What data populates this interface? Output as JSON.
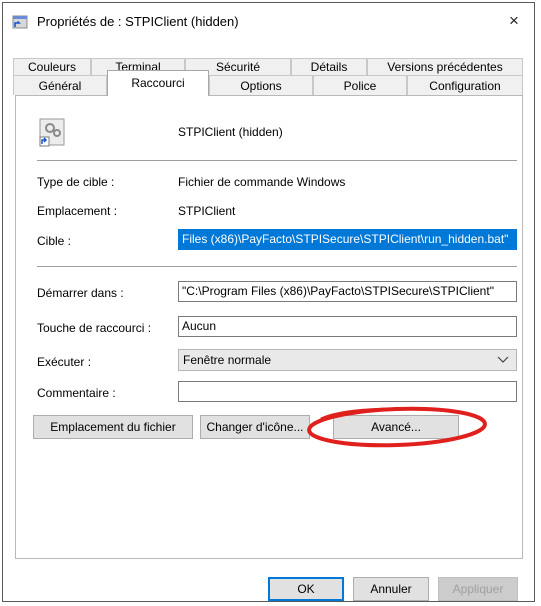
{
  "window": {
    "title": "Propriétés de : STPIClient (hidden)",
    "close_glyph": "×"
  },
  "tabs_row1": [
    "Couleurs",
    "Terminal",
    "Sécurité",
    "Détails",
    "Versions précédentes"
  ],
  "tabs_row2": [
    "Général",
    "Raccourci",
    "Options",
    "Police",
    "Configuration"
  ],
  "active_tab": "Raccourci",
  "header": {
    "name": "STPIClient (hidden)"
  },
  "info": {
    "type_label": "Type de cible :",
    "type_value": "Fichier de commande Windows",
    "location_label": "Emplacement :",
    "location_value": "STPIClient",
    "target_label": "Cible :",
    "target_value": "Files (x86)\\PayFacto\\STPISecure\\STPIClient\\run_hidden.bat\""
  },
  "fields": {
    "start_label": "Démarrer dans :",
    "start_value": "\"C:\\Program Files (x86)\\PayFacto\\STPISecure\\STPIClient\"",
    "shortcut_label": "Touche de raccourci :",
    "shortcut_value": "Aucun",
    "run_label": "Exécuter :",
    "run_value": "Fenêtre normale",
    "comment_label": "Commentaire :",
    "comment_value": ""
  },
  "buttons": {
    "file_location": "Emplacement du fichier",
    "change_icon": "Changer d'icône...",
    "advanced": "Avancé...",
    "ok": "OK",
    "cancel": "Annuler",
    "apply": "Appliquer"
  },
  "icons": {
    "title": "shortcut-file-icon",
    "file": "batch-file-shortcut-icon",
    "dropdown": "chevron-down-icon",
    "close": "close-icon"
  },
  "colors": {
    "selection": "#0078d7",
    "highlight_circle": "#e0201c"
  }
}
